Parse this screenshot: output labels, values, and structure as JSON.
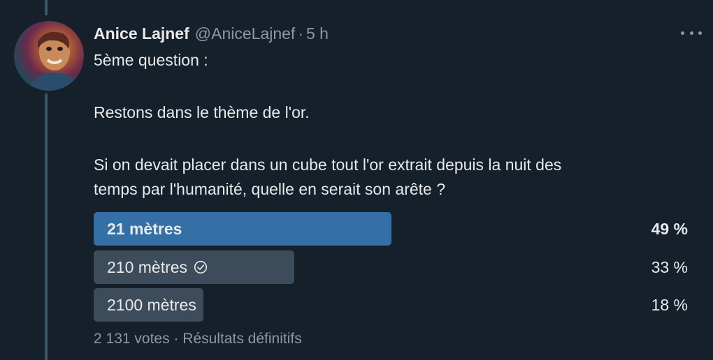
{
  "tweet": {
    "author_name": "Anice Lajnef",
    "handle": "@AniceLajnef",
    "separator": "·",
    "time": "5 h",
    "lines": [
      "5ème question :",
      "Restons dans le thème de l'or.",
      "Si on devait placer dans un cube tout l'or extrait depuis la nuit des",
      "temps par l'humanité, quelle en serait son arête ?"
    ]
  },
  "poll": {
    "options": [
      {
        "label": "21 mètres",
        "percent_text": "49 %",
        "percent": 49,
        "winner": true,
        "checked": false
      },
      {
        "label": "210 mètres",
        "percent_text": "33 %",
        "percent": 33,
        "winner": false,
        "checked": true
      },
      {
        "label": "2100 mètres",
        "percent_text": "18 %",
        "percent": 18,
        "winner": false,
        "checked": false
      }
    ],
    "votes": "2 131 votes",
    "separator": "·",
    "status": "Résultats définitifs"
  },
  "colors": {
    "background": "#15202b",
    "winner_bar": "#3470a6",
    "other_bar": "#3c4c5a",
    "muted_text": "#8b98a5"
  },
  "icons": [
    "more-options-icon",
    "check-circle-icon"
  ]
}
